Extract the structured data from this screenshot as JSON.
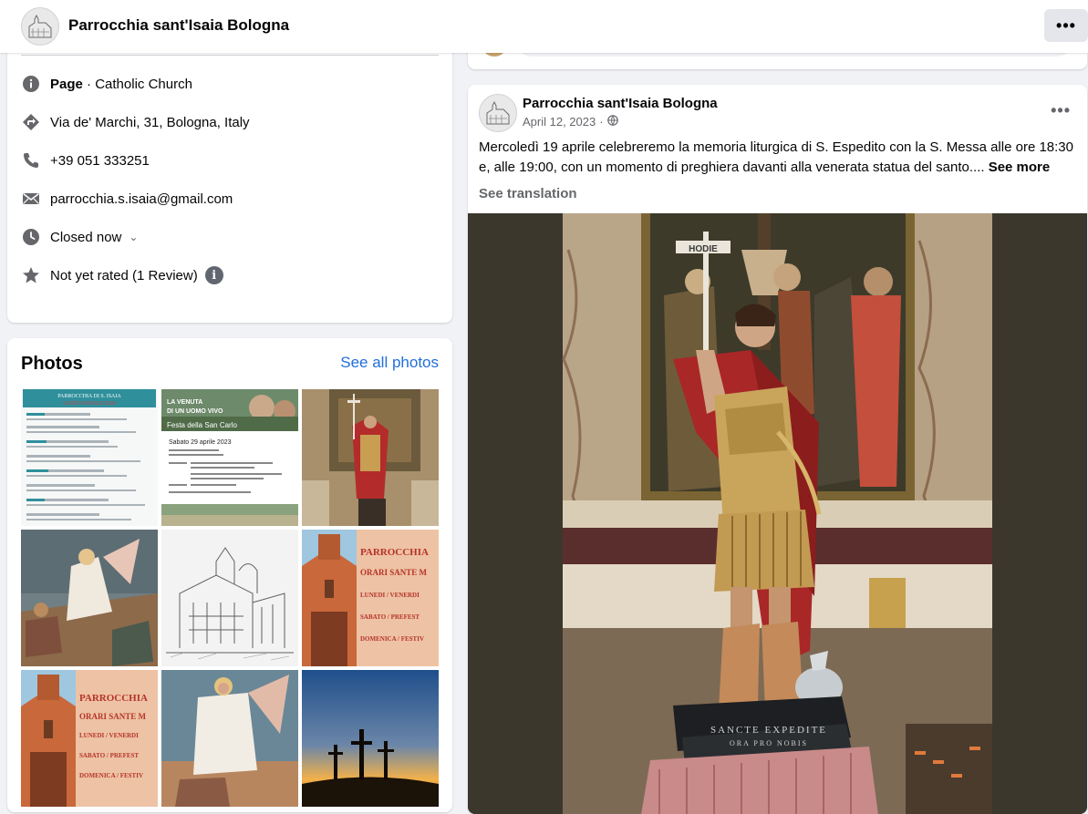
{
  "header": {
    "page_name": "Parrocchia sant'Isaia Bologna",
    "more_label": "•••"
  },
  "intro": {
    "category_label": "Page",
    "category_sep": " · ",
    "category_value": "Catholic Church",
    "address": "Via de' Marchi, 31, Bologna, Italy",
    "phone": "+39 051 333251",
    "email": "parrocchia.s.isaia@gmail.com",
    "hours_status": "Closed now",
    "rating": "Not yet rated (1 Review)",
    "icons": [
      "info-icon",
      "directions-icon",
      "phone-icon",
      "email-icon",
      "clock-icon",
      "star-icon"
    ]
  },
  "photos": {
    "heading": "Photos",
    "see_all": "See all photos",
    "tiles": [
      {
        "name": "photo-christmas-schedule",
        "title": "PARROCCHIA DI S. ISAIA",
        "subtitle": "SANTO NATALE 2024"
      },
      {
        "name": "photo-festa-san-carlo",
        "title": "LA VENUTA DI UN UOMO VIVO",
        "subtitle": "Festa della San Carlo",
        "date": "Sabato 29 aprile 2023"
      },
      {
        "name": "photo-statue-small"
      },
      {
        "name": "photo-fresco-angel"
      },
      {
        "name": "photo-church-drawing"
      },
      {
        "name": "photo-orari-1",
        "title": "PARROCCHIA",
        "lines": [
          "ORARI SANTE M",
          "LUNEDI / VENERDI",
          "SABATO / PREFEST",
          "DOMENICA / FESTIV"
        ]
      },
      {
        "name": "photo-orari-2",
        "title": "PARROCCHIA",
        "lines": [
          "ORARI SANTE M",
          "LUNEDI / VENERDI",
          "SABATO / PREFEST",
          "DOMENICA / FESTIV"
        ]
      },
      {
        "name": "photo-angel-tomb"
      },
      {
        "name": "photo-three-crosses"
      }
    ]
  },
  "post": {
    "author": "Parrocchia sant'Isaia Bologna",
    "date": "April 12, 2023",
    "more_label": "•••",
    "text": "Mercoledì 19 aprile celebreremo la memoria liturgica di S. Espedito con la S. Messa alle ore 18:30 e, alle 19:00, con un momento di preghiera davanti alla venerata statua del santo.... ",
    "see_more": "See more",
    "see_translation": "See translation",
    "image": {
      "cross_label": "HODIE",
      "base_label_1": "SANCTE EXPEDITE",
      "base_label_2": "ORA PRO NOBIS"
    }
  },
  "colors": {
    "link_blue": "#216fdb",
    "closed_red": "#c13840",
    "secondary_text": "#65676b",
    "background": "#f0f2f5"
  }
}
